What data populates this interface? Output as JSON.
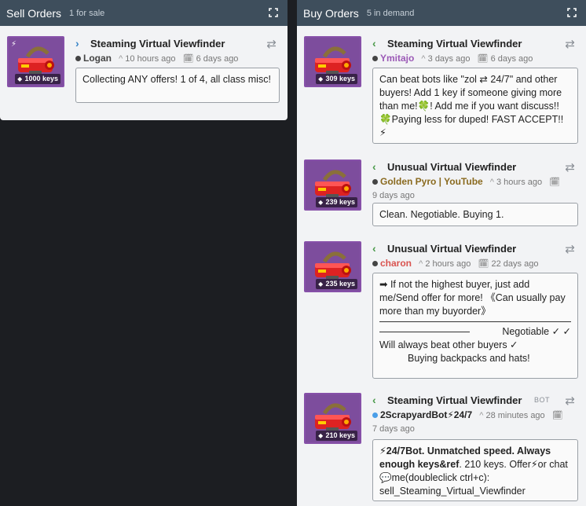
{
  "sell": {
    "title": "Sell Orders",
    "count": "1 for sale",
    "orders": [
      {
        "name": "Steaming Virtual Viewfinder",
        "price": "1000 keys",
        "user": "Logan",
        "bumped": "10 hours ago",
        "listed": "6 days ago",
        "message": "Collecting ANY offers! 1 of 4, all class misc!"
      }
    ]
  },
  "buy": {
    "title": "Buy Orders",
    "count": "5 in demand",
    "orders": [
      {
        "name": "Steaming Virtual Viewfinder",
        "price": "309 keys",
        "user": "Ymitajo",
        "user_color": "#9b59b6",
        "bumped": "3 days ago",
        "listed": "6 days ago",
        "message": "Can beat bots like \"zol ⇄ 24/7\" and other buyers! Add 1 key if someone giving more than me!🍀! Add me if you want discuss!! 🍀Paying less for duped! FAST ACCEPT!! ⚡"
      },
      {
        "name": "Unusual Virtual Viewfinder",
        "price": "239 keys",
        "user": "Golden Pyro | YouTube",
        "user_color": "#8a6a1f",
        "bumped": "3 hours ago",
        "listed": "9 days ago",
        "message": "Clean. Negotiable. Buying 1."
      },
      {
        "name": "Unusual Virtual Viewfinder",
        "price": "235 keys",
        "user": "charon",
        "user_color": "#d9534f",
        "bumped": "2 hours ago",
        "listed": "22 days ago",
        "message_lines": [
          "➡ If not the highest buyer, just add me/Send offer for more!              《Can usually pay more than my buyorder》",
          "Negotiable ✓   ✓",
          "Will always beat other buyers ✓",
          "Buying backpacks and hats!"
        ]
      },
      {
        "name": "Steaming Virtual Viewfinder",
        "price": "210 keys",
        "user": "2ScrapyardBot⚡24/7",
        "user_color": "#222222",
        "bot_label": "BOT",
        "bumped": "28 minutes ago",
        "listed": "7 days ago",
        "message_bold": "⚡24/7Bot. Unmatched speed. Always enough keys&ref",
        "message_rest": ". 210 keys. Offer⚡or chat💬me(doubleclick ctrl+c): sell_Steaming_Virtual_Viewfinder"
      }
    ]
  },
  "icons": {
    "expand": "expand-icon",
    "swap": "swap-arrows-icon",
    "bump": "caret-up-icon",
    "calendar": "calendar-icon",
    "tag": "price-tag-icon"
  },
  "colors": {
    "header_bg": "#3e4e5c",
    "panel_bg": "#f2f3f5",
    "item_bg": "#7d4d9d",
    "sell_chevron": "#3a86c8",
    "buy_chevron": "#4a9a4a"
  }
}
